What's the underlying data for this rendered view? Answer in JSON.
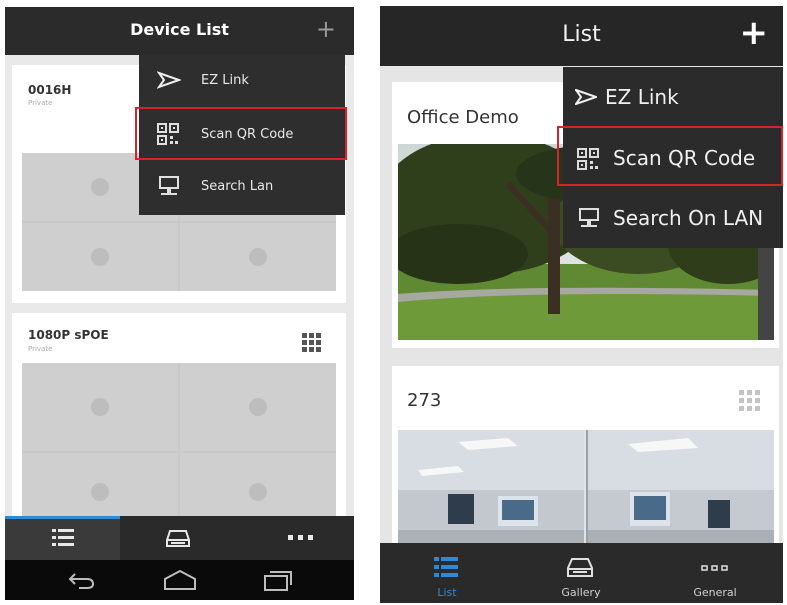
{
  "left_screen": {
    "header": {
      "title": "Device List",
      "add_icon": "plus-icon"
    },
    "cards": [
      {
        "name": "0016H",
        "subtitle": "Private"
      },
      {
        "name": "1080P sPOE",
        "subtitle": "Private",
        "grid_icon": "grid-dots-icon"
      }
    ],
    "menu": [
      {
        "label": "EZ Link",
        "icon": "send-arrow-icon"
      },
      {
        "label": "Scan QR Code",
        "icon": "qr-code-icon",
        "highlighted": true
      },
      {
        "label": "Search Lan",
        "icon": "monitor-icon"
      }
    ],
    "bottom_tabs": [
      {
        "icon": "list-icon",
        "selected": true
      },
      {
        "icon": "gallery-icon"
      },
      {
        "icon": "more-dots-icon"
      }
    ],
    "nav_bar": [
      "back-icon",
      "home-icon",
      "recent-apps-icon"
    ],
    "highlight_color": "#d5232b",
    "accent_color": "#2f8ad6"
  },
  "right_screen": {
    "header": {
      "title": "List",
      "add_icon": "plus-icon"
    },
    "cards": [
      {
        "name": "Office Demo"
      },
      {
        "name": "273",
        "grid_icon": "grid-dots-icon"
      }
    ],
    "menu": [
      {
        "label": "EZ Link",
        "icon": "send-arrow-icon"
      },
      {
        "label": "Scan QR Code",
        "icon": "qr-code-icon",
        "highlighted": true
      },
      {
        "label": "Search On LAN",
        "icon": "monitor-icon"
      }
    ],
    "bottom_tabs": [
      {
        "label": "List",
        "icon": "list-icon",
        "selected": true
      },
      {
        "label": "Gallery",
        "icon": "gallery-icon"
      },
      {
        "label": "General",
        "icon": "more-dots-icon"
      }
    ],
    "accent_color": "#2f8ad6"
  }
}
